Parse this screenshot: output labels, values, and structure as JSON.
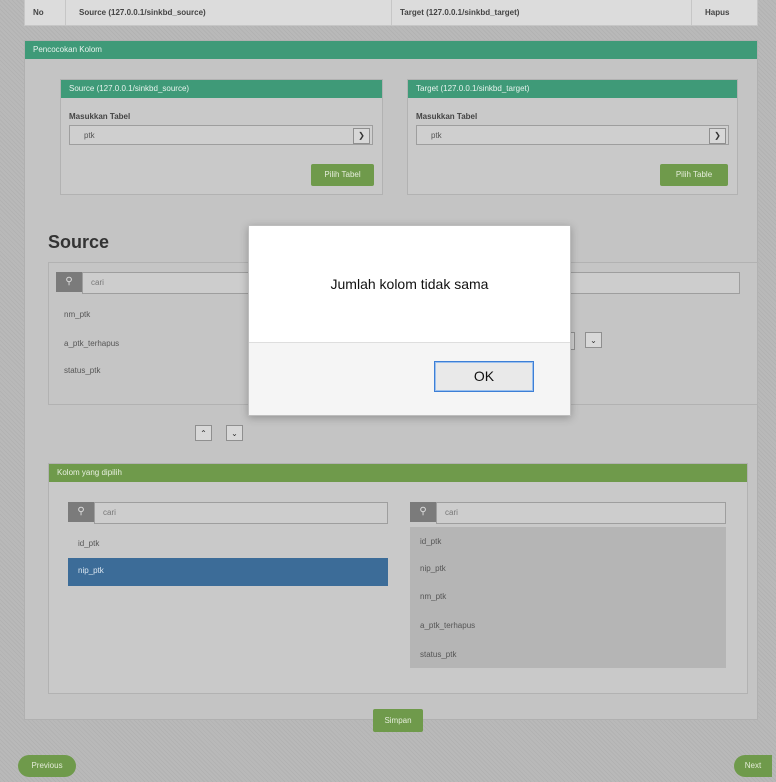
{
  "table_header": {
    "no": "No",
    "source": "Source (127.0.0.1/sinkbd_source)",
    "target": "Target (127.0.0.1/sinkbd_target)",
    "hapus": "Hapus"
  },
  "pencocokan": {
    "title": "Pencocokan Kolom",
    "source_panel": {
      "title": "Source (127.0.0.1/sinkbd_source)",
      "label": "Masukkan Tabel",
      "selected": "ptk",
      "button": "Pilih Tabel"
    },
    "target_panel": {
      "title": "Target (127.0.0.1/sinkbd_target)",
      "label": "Masukkan Tabel",
      "selected": "ptk",
      "button": "Pilih Table"
    }
  },
  "source_section": {
    "heading": "Source",
    "search_placeholder": "cari",
    "items": [
      "nm_ptk",
      "a_ptk_terhapus",
      "status_ptk"
    ]
  },
  "kolom": {
    "title": "Kolom yang dipilih",
    "left_placeholder": "cari",
    "left_items": [
      "id_ptk",
      "nip_ptk"
    ],
    "right_placeholder": "cari",
    "right_items": [
      "id_ptk",
      "nip_ptk",
      "nm_ptk",
      "a_ptk_terhapus",
      "status_ptk"
    ]
  },
  "buttons": {
    "simpan": "Simpan",
    "previous": "Previous",
    "next": "Next"
  },
  "modal": {
    "message": "Jumlah kolom tidak sama",
    "ok": "OK"
  },
  "colors": {
    "teal_header": "#3f9a78",
    "green": "#6f9a4b",
    "selected_blue": "#3c6c98"
  }
}
